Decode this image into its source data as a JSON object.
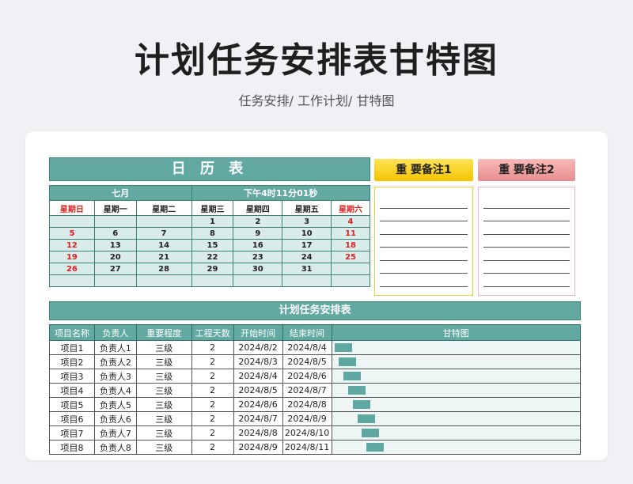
{
  "title": "计划任务安排表甘特图",
  "subtitle": "任务安排/  工作计划/  甘特图",
  "calendar": {
    "heading": "日 历 表",
    "month": "七月",
    "time": "下午4时11分01秒",
    "weekdays": [
      "星期日",
      "星期一",
      "星期二",
      "星期三",
      "星期四",
      "星期五",
      "星期六"
    ],
    "weeks": [
      [
        "",
        "",
        "",
        "1",
        "2",
        "3",
        "4"
      ],
      [
        "5",
        "6",
        "7",
        "8",
        "9",
        "10",
        "11"
      ],
      [
        "12",
        "13",
        "14",
        "15",
        "16",
        "17",
        "18"
      ],
      [
        "19",
        "20",
        "21",
        "22",
        "23",
        "24",
        "25"
      ],
      [
        "26",
        "27",
        "28",
        "29",
        "30",
        "31",
        ""
      ],
      [
        "",
        "",
        "",
        "",
        "",
        "",
        ""
      ]
    ]
  },
  "notes": {
    "note1": "重 要备注1",
    "note2": "重 要备注2"
  },
  "plan": {
    "heading": "计划任务安排表",
    "columns": [
      "项目名称",
      "负责人",
      "重要程度",
      "工程天数",
      "开始时间",
      "结束时间",
      "甘特图"
    ],
    "rows": [
      [
        "项目1",
        "负责人1",
        "三级",
        "2",
        "2024/8/2",
        "2024/8/4"
      ],
      [
        "项目2",
        "负责人2",
        "三级",
        "2",
        "2024/8/3",
        "2024/8/5"
      ],
      [
        "项目3",
        "负责人3",
        "三级",
        "2",
        "2024/8/4",
        "2024/8/6"
      ],
      [
        "项目4",
        "负责人4",
        "三级",
        "2",
        "2024/8/5",
        "2024/8/7"
      ],
      [
        "项目5",
        "负责人5",
        "三级",
        "2",
        "2024/8/6",
        "2024/8/8"
      ],
      [
        "项目6",
        "负责人6",
        "三级",
        "2",
        "2024/8/7",
        "2024/8/9"
      ],
      [
        "项目7",
        "负责人7",
        "三级",
        "2",
        "2024/8/8",
        "2024/8/10"
      ],
      [
        "项目8",
        "负责人8",
        "三级",
        "2",
        "2024/8/9",
        "2024/8/11"
      ]
    ]
  },
  "colors": {
    "teal": "#62a9a2",
    "red": "#e02020",
    "yellow": "#f4c400",
    "pink": "#e58e8e"
  }
}
